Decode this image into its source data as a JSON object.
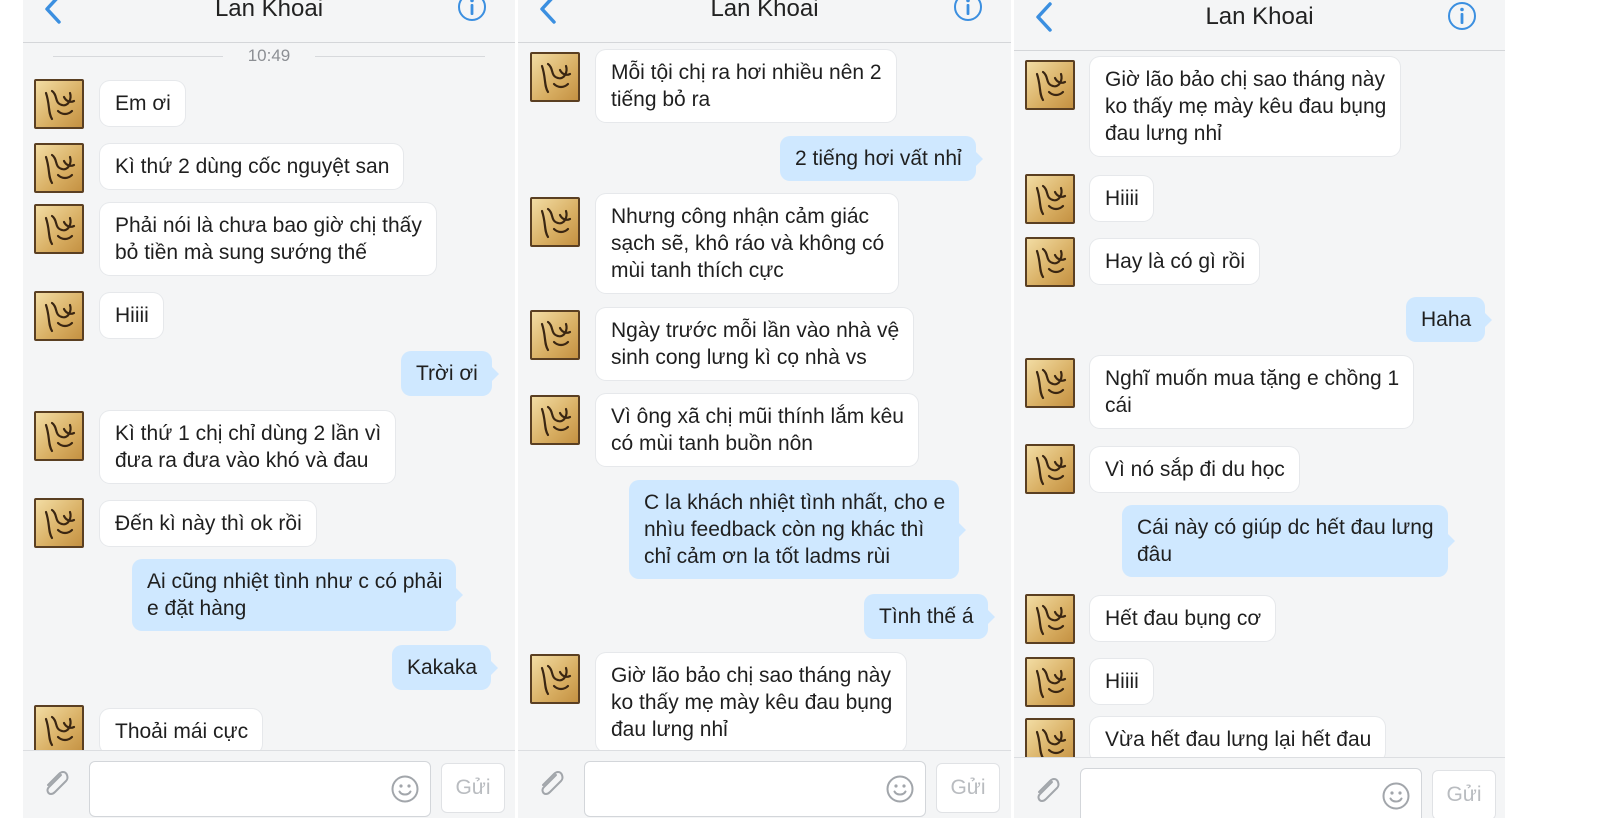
{
  "panels": [
    {
      "title": "Lan Khoai",
      "time": "10:49",
      "messages": [
        {
          "from": "them",
          "lines": [
            "Em ơi"
          ]
        },
        {
          "from": "them",
          "lines": [
            "Kì thứ 2 dùng cốc nguyệt san"
          ]
        },
        {
          "from": "them",
          "lines": [
            "Phải nói là chưa bao giờ chị thấy",
            "bỏ tiền mà sung sướng thế"
          ]
        },
        {
          "from": "them",
          "lines": [
            "Hiiii"
          ]
        },
        {
          "from": "me",
          "lines": [
            "Trời ơi"
          ]
        },
        {
          "from": "them",
          "lines": [
            "Kì thứ 1 chị chỉ dùng 2 lần vì",
            "đưa ra đưa vào khó và đau"
          ]
        },
        {
          "from": "them",
          "lines": [
            "Đến kì này thì ok rồi"
          ]
        },
        {
          "from": "me",
          "lines": [
            "Ai cũng nhiệt tình như c có phải",
            "e đặt hàng"
          ]
        },
        {
          "from": "me",
          "lines": [
            "Kakaka"
          ]
        },
        {
          "from": "them",
          "lines": [
            "Thoải mái cực"
          ]
        }
      ],
      "send_label": "Gửi"
    },
    {
      "title": "Lan Khoai",
      "messages": [
        {
          "from": "them",
          "lines": [
            "Mỗi tội chị ra hơi nhiều nên 2",
            "tiếng bỏ ra"
          ]
        },
        {
          "from": "me",
          "lines": [
            "2 tiếng hơi vất nhỉ"
          ]
        },
        {
          "from": "them",
          "lines": [
            "Nhưng công nhận cảm giác",
            "sạch sẽ, khô ráo và không có",
            "mùi tanh thích cực"
          ]
        },
        {
          "from": "them",
          "lines": [
            "Ngày trước mỗi lần vào nhà vệ",
            "sinh cong lưng kì cọ nhà vs"
          ]
        },
        {
          "from": "them",
          "lines": [
            "Vì ông xã chị mũi thính lắm kêu",
            "có mùi tanh buồn nôn"
          ]
        },
        {
          "from": "me",
          "lines": [
            "C la khách nhiệt tình nhất, cho e",
            "nhìu feedback còn ng khác thì",
            "chỉ cảm ơn la tốt ladms rùi"
          ]
        },
        {
          "from": "me",
          "lines": [
            "Tình thế á"
          ]
        },
        {
          "from": "them",
          "lines": [
            "Giờ lão bảo chị sao tháng này",
            "ko thấy mẹ mày kêu đau bụng",
            "đau lưng nhỉ"
          ]
        }
      ],
      "send_label": "Gửi"
    },
    {
      "title": "Lan Khoai",
      "messages": [
        {
          "from": "them",
          "lines": [
            "Giờ lão bảo chị sao tháng này",
            "ko thấy mẹ mày kêu đau bụng",
            "đau lưng nhỉ"
          ]
        },
        {
          "from": "them",
          "lines": [
            "Hiiii"
          ]
        },
        {
          "from": "them",
          "lines": [
            "Hay là có gì rồi"
          ]
        },
        {
          "from": "me",
          "lines": [
            "Haha"
          ]
        },
        {
          "from": "them",
          "lines": [
            "Nghĩ muốn mua tặng e chồng 1",
            "cái"
          ]
        },
        {
          "from": "them",
          "lines": [
            "Vì nó sắp đi du học"
          ]
        },
        {
          "from": "me",
          "lines": [
            "Cái này có giúp dc hết đau lưng",
            "đâu"
          ]
        },
        {
          "from": "them",
          "lines": [
            "Hết đau bụng cơ"
          ]
        },
        {
          "from": "them",
          "lines": [
            "Hiiii"
          ]
        },
        {
          "from": "them",
          "lines": [
            "Vừa hết đau lưng lại hết đau"
          ]
        }
      ],
      "send_label": "Gửi"
    }
  ],
  "colors": {
    "incoming_bubble": "#ffffff",
    "outgoing_bubble": "#cfe8ff",
    "accent": "#3b8fe0",
    "background": "#f4f5f6"
  },
  "icons": [
    "back-icon",
    "info-icon",
    "attach-icon",
    "emoji-icon",
    "avatar"
  ]
}
